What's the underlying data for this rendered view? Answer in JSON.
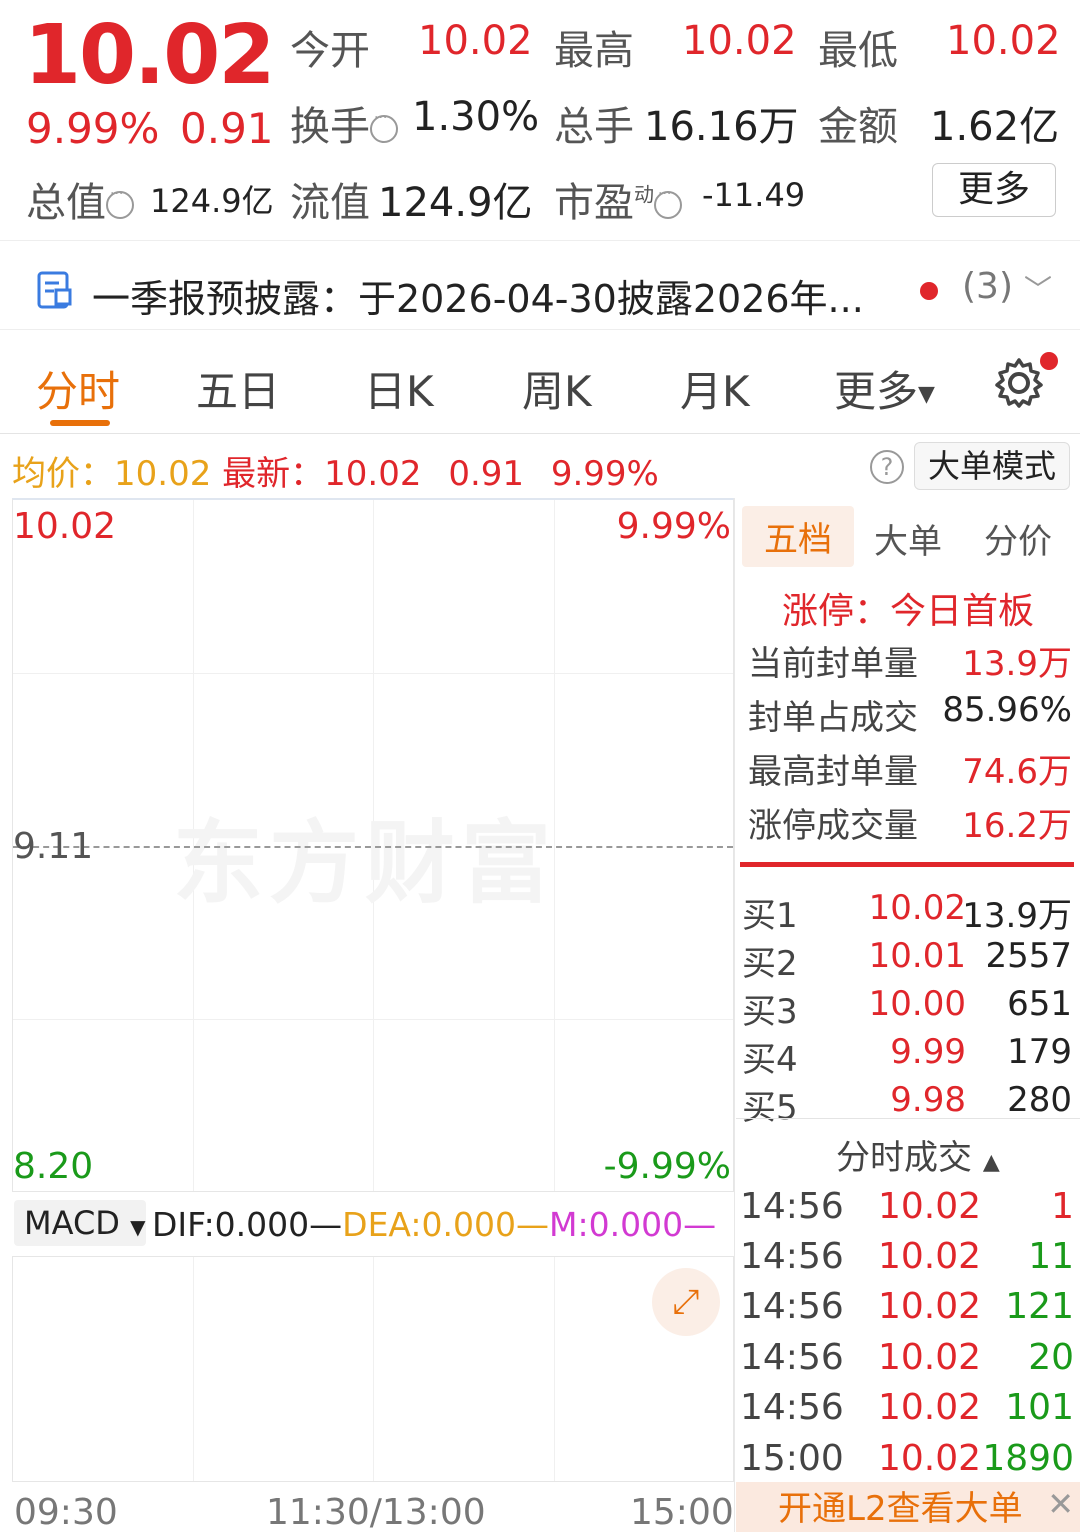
{
  "quote": {
    "price": "10.02",
    "change_pct": "9.99%",
    "change_amt": "0.91",
    "open_label": "今开",
    "open": "10.02",
    "high_label": "最高",
    "high": "10.02",
    "low_label": "最低",
    "low": "10.02",
    "turnover_label": "换手",
    "turnover": "1.30%",
    "volume_label": "总手",
    "volume": "16.16万",
    "amount_label": "金额",
    "amount": "1.62亿",
    "total_cap_label": "总值",
    "total_cap": "124.9亿",
    "float_cap_label": "流值",
    "float_cap": "124.9亿",
    "pe_label": "市盈",
    "pe_sup": "动",
    "pe": "-11.49",
    "more_button": "更多"
  },
  "notice": {
    "text": "一季报预披露：于2026-04-30披露2026年...",
    "count": "(3)"
  },
  "tabs": [
    "分时",
    "五日",
    "日K",
    "周K",
    "月K",
    "更多"
  ],
  "avg_line": {
    "avg_label": "均价：",
    "avg": "10.02",
    "latest_label": "最新：",
    "latest": "10.02",
    "change": "0.91",
    "change_pct": "9.99%",
    "help": "?",
    "big_order_button": "大单模式"
  },
  "chart": {
    "y_top": "10.02",
    "y_mid": "9.11",
    "y_bottom": "8.20",
    "pct_top": "9.99%",
    "pct_bottom": "-9.99%",
    "time_start": "09:30",
    "time_mid": "11:30/13:00",
    "time_end": "15:00"
  },
  "macd": {
    "selector": "MACD",
    "dif": "DIF:0.000—",
    "dea": "DEA:0.000—",
    "m": "M:0.000—"
  },
  "right_panel": {
    "tabs": [
      "五档",
      "大单",
      "分价"
    ],
    "limit_title": "涨停：今日首板",
    "seal": [
      {
        "label": "当前封单量",
        "value": "13.9万"
      },
      {
        "label": "封单占成交",
        "value": "85.96%"
      },
      {
        "label": "最高封单量",
        "value": "74.6万"
      },
      {
        "label": "涨停成交量",
        "value": "16.2万"
      }
    ],
    "bids": [
      {
        "label": "买1",
        "price": "10.02",
        "qty": "13.9万"
      },
      {
        "label": "买2",
        "price": "10.01",
        "qty": "2557"
      },
      {
        "label": "买3",
        "price": "10.00",
        "qty": "651"
      },
      {
        "label": "买4",
        "price": "9.99",
        "qty": "179"
      },
      {
        "label": "买5",
        "price": "9.98",
        "qty": "280"
      }
    ],
    "trades_title": "分时成交",
    "trades": [
      {
        "time": "14:56",
        "price": "10.02",
        "vol": "1"
      },
      {
        "time": "14:56",
        "price": "10.02",
        "vol": "11"
      },
      {
        "time": "14:56",
        "price": "10.02",
        "vol": "121"
      },
      {
        "time": "14:56",
        "price": "10.02",
        "vol": "20"
      },
      {
        "time": "14:56",
        "price": "10.02",
        "vol": "101"
      },
      {
        "time": "15:00",
        "price": "10.02",
        "vol": "1890"
      }
    ],
    "l2_banner": "开通L2查看大单"
  },
  "watermark": "东方财富",
  "colors": {
    "up": "#e0262b",
    "down": "#1a9a1a",
    "accent": "#e8700a",
    "avg": "#e8a21a"
  }
}
